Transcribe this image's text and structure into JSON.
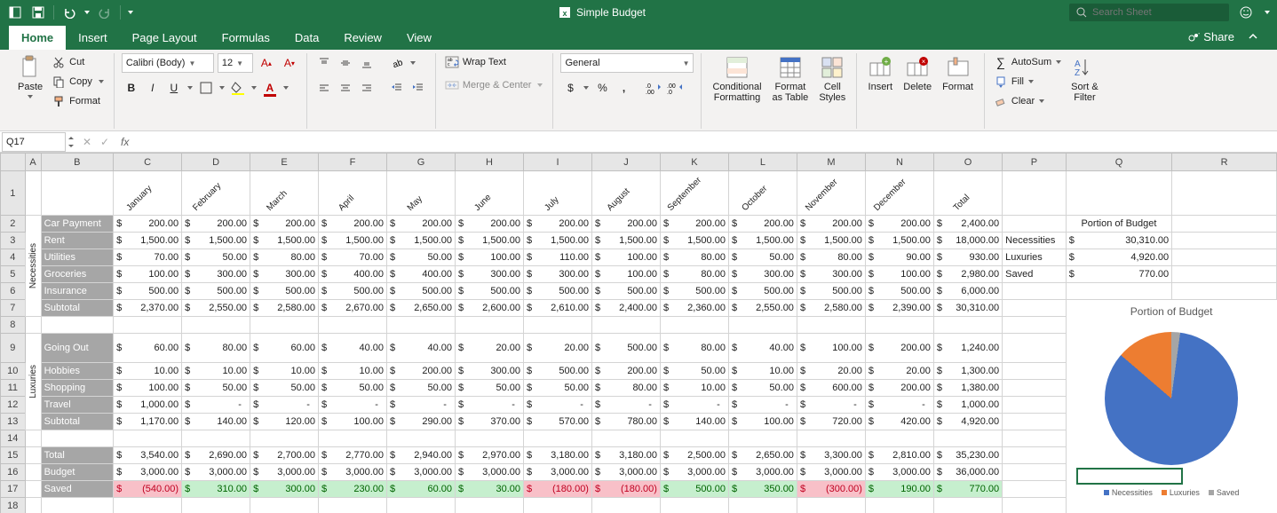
{
  "title": "Simple Budget",
  "search_placeholder": "Search Sheet",
  "tabs": [
    "Home",
    "Insert",
    "Page Layout",
    "Formulas",
    "Data",
    "Review",
    "View"
  ],
  "share_label": "Share",
  "clipboard": {
    "paste": "Paste",
    "cut": "Cut",
    "copy": "Copy",
    "format": "Format"
  },
  "font": {
    "name": "Calibri (Body)",
    "size": "12"
  },
  "alignment": {
    "wrap": "Wrap Text",
    "merge": "Merge & Center"
  },
  "number": {
    "format": "General"
  },
  "styles": {
    "cond": "Conditional\nFormatting",
    "table": "Format\nas Table",
    "cell": "Cell\nStyles"
  },
  "cells": {
    "insert": "Insert",
    "delete": "Delete",
    "format": "Format"
  },
  "editing": {
    "autosum": "AutoSum",
    "fill": "Fill",
    "clear": "Clear",
    "sortfilter": "Sort &\nFilter"
  },
  "namebox": "Q17",
  "cols": [
    "A",
    "B",
    "C",
    "D",
    "E",
    "F",
    "G",
    "H",
    "I",
    "J",
    "K",
    "L",
    "M",
    "N",
    "O",
    "P",
    "Q",
    "R"
  ],
  "months": [
    "January",
    "February",
    "March",
    "April",
    "May",
    "June",
    "July",
    "August",
    "September",
    "October",
    "November",
    "December",
    "Total"
  ],
  "necessities_label": "Necessities",
  "luxuries_label": "Luxuries",
  "necessities": {
    "rows": [
      {
        "label": "Car Payment",
        "vals": [
          "200.00",
          "200.00",
          "200.00",
          "200.00",
          "200.00",
          "200.00",
          "200.00",
          "200.00",
          "200.00",
          "200.00",
          "200.00",
          "200.00",
          "2,400.00"
        ]
      },
      {
        "label": "Rent",
        "vals": [
          "1,500.00",
          "1,500.00",
          "1,500.00",
          "1,500.00",
          "1,500.00",
          "1,500.00",
          "1,500.00",
          "1,500.00",
          "1,500.00",
          "1,500.00",
          "1,500.00",
          "1,500.00",
          "18,000.00"
        ]
      },
      {
        "label": "Utilities",
        "vals": [
          "70.00",
          "50.00",
          "80.00",
          "70.00",
          "50.00",
          "100.00",
          "110.00",
          "100.00",
          "80.00",
          "50.00",
          "80.00",
          "90.00",
          "930.00"
        ]
      },
      {
        "label": "Groceries",
        "vals": [
          "100.00",
          "300.00",
          "300.00",
          "400.00",
          "400.00",
          "300.00",
          "300.00",
          "100.00",
          "80.00",
          "300.00",
          "300.00",
          "100.00",
          "2,980.00"
        ]
      },
      {
        "label": "Insurance",
        "vals": [
          "500.00",
          "500.00",
          "500.00",
          "500.00",
          "500.00",
          "500.00",
          "500.00",
          "500.00",
          "500.00",
          "500.00",
          "500.00",
          "500.00",
          "6,000.00"
        ]
      }
    ],
    "subtotal": {
      "label": "Subtotal",
      "vals": [
        "2,370.00",
        "2,550.00",
        "2,580.00",
        "2,670.00",
        "2,650.00",
        "2,600.00",
        "2,610.00",
        "2,400.00",
        "2,360.00",
        "2,550.00",
        "2,580.00",
        "2,390.00",
        "30,310.00"
      ]
    }
  },
  "luxuries": {
    "rows": [
      {
        "label": "Going Out",
        "vals": [
          "60.00",
          "80.00",
          "60.00",
          "40.00",
          "40.00",
          "20.00",
          "20.00",
          "500.00",
          "80.00",
          "40.00",
          "100.00",
          "200.00",
          "1,240.00"
        ]
      },
      {
        "label": "Hobbies",
        "vals": [
          "10.00",
          "10.00",
          "10.00",
          "10.00",
          "200.00",
          "300.00",
          "500.00",
          "200.00",
          "50.00",
          "10.00",
          "20.00",
          "20.00",
          "1,300.00"
        ]
      },
      {
        "label": "Shopping",
        "vals": [
          "100.00",
          "50.00",
          "50.00",
          "50.00",
          "50.00",
          "50.00",
          "50.00",
          "80.00",
          "10.00",
          "50.00",
          "600.00",
          "200.00",
          "1,380.00"
        ]
      },
      {
        "label": "Travel",
        "vals": [
          "1,000.00",
          "-",
          "-",
          "-",
          "-",
          "-",
          "-",
          "-",
          "-",
          "-",
          "-",
          "-",
          "1,000.00"
        ]
      }
    ],
    "subtotal": {
      "label": "Subtotal",
      "vals": [
        "1,170.00",
        "140.00",
        "120.00",
        "100.00",
        "290.00",
        "370.00",
        "570.00",
        "780.00",
        "140.00",
        "100.00",
        "720.00",
        "420.00",
        "4,920.00"
      ]
    }
  },
  "totals": [
    {
      "label": "Total",
      "vals": [
        "3,540.00",
        "2,690.00",
        "2,700.00",
        "2,770.00",
        "2,940.00",
        "2,970.00",
        "3,180.00",
        "3,180.00",
        "2,500.00",
        "2,650.00",
        "3,300.00",
        "2,810.00",
        "35,230.00"
      ]
    },
    {
      "label": "Budget",
      "vals": [
        "3,000.00",
        "3,000.00",
        "3,000.00",
        "3,000.00",
        "3,000.00",
        "3,000.00",
        "3,000.00",
        "3,000.00",
        "3,000.00",
        "3,000.00",
        "3,000.00",
        "3,000.00",
        "36,000.00"
      ]
    },
    {
      "label": "Saved",
      "vals": [
        "(540.00)",
        "310.00",
        "300.00",
        "230.00",
        "60.00",
        "30.00",
        "(180.00)",
        "(180.00)",
        "500.00",
        "350.00",
        "(300.00)",
        "190.00",
        "770.00"
      ],
      "colors": [
        "neg",
        "pos",
        "pos",
        "pos",
        "pos",
        "pos",
        "neg",
        "neg",
        "pos",
        "pos",
        "neg",
        "pos",
        "pos"
      ]
    }
  ],
  "portion": {
    "title": "Portion of Budget",
    "rows": [
      {
        "label": "Necessities",
        "val": "30,310.00"
      },
      {
        "label": "Luxuries",
        "val": "4,920.00"
      },
      {
        "label": "Saved",
        "val": "770.00"
      }
    ]
  },
  "chart_data": {
    "type": "pie",
    "title": "Portion of Budget",
    "categories": [
      "Necessities",
      "Luxuries",
      "Saved"
    ],
    "values": [
      30310.0,
      4920.0,
      770.0
    ],
    "colors": [
      "#4472c4",
      "#ed7d31",
      "#a5a5a5"
    ]
  }
}
